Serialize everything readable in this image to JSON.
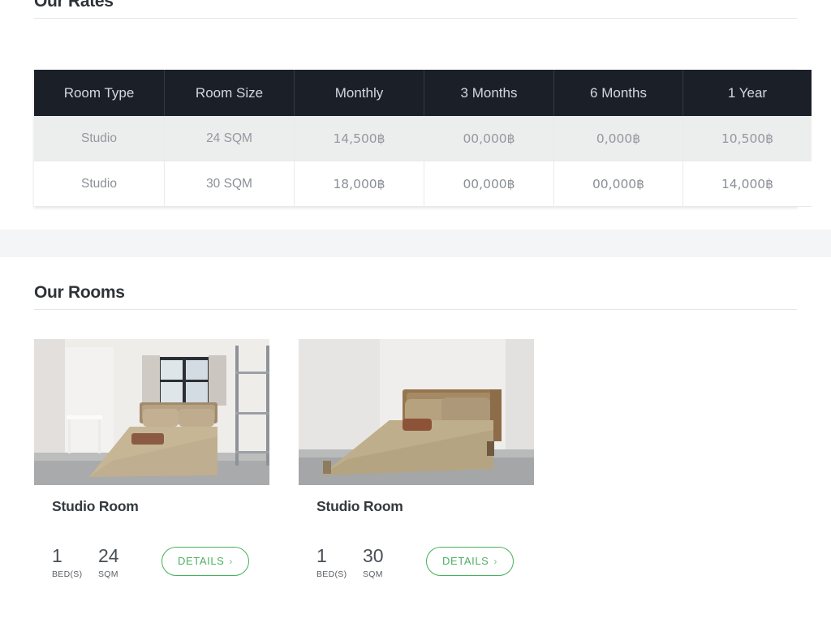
{
  "rates": {
    "title": "Our Rates",
    "columns": [
      "Room Type",
      "Room Size",
      "Monthly",
      "3 Months",
      "6 Months",
      "1 Year"
    ],
    "rows": [
      {
        "room_type": "Studio",
        "room_size": "24 SQM",
        "monthly": "14,500฿",
        "three_months": "00,000฿",
        "six_months": "0,000฿",
        "one_year": "10,500฿"
      },
      {
        "room_type": "Studio",
        "room_size": "30 SQM",
        "monthly": "18,000฿",
        "three_months": "00,000฿",
        "six_months": "00,000฿",
        "one_year": "14,000฿"
      }
    ]
  },
  "rooms": {
    "title": "Our Rooms",
    "cards": [
      {
        "name": "Studio Room",
        "beds": "1",
        "beds_label": "BED(S)",
        "size": "24",
        "size_label": "SQM",
        "details_label": "DETAILS",
        "details_chevron": "›",
        "photo_alt": "studio-room-with-window-desk-and-shelf"
      },
      {
        "name": "Studio Room",
        "beds": "1",
        "beds_label": "BED(S)",
        "size": "30",
        "size_label": "SQM",
        "details_label": "DETAILS",
        "details_chevron": "›",
        "photo_alt": "studio-room-with-bed-against-plain-wall"
      }
    ]
  },
  "colors": {
    "table_header_bg": "#1b2028",
    "table_header_text": "#d3d7de",
    "row_alt_bg": "#eceded",
    "accent_green": "#4caf62",
    "band_bg": "#f4f5f6",
    "heading_text": "#2f3337"
  }
}
